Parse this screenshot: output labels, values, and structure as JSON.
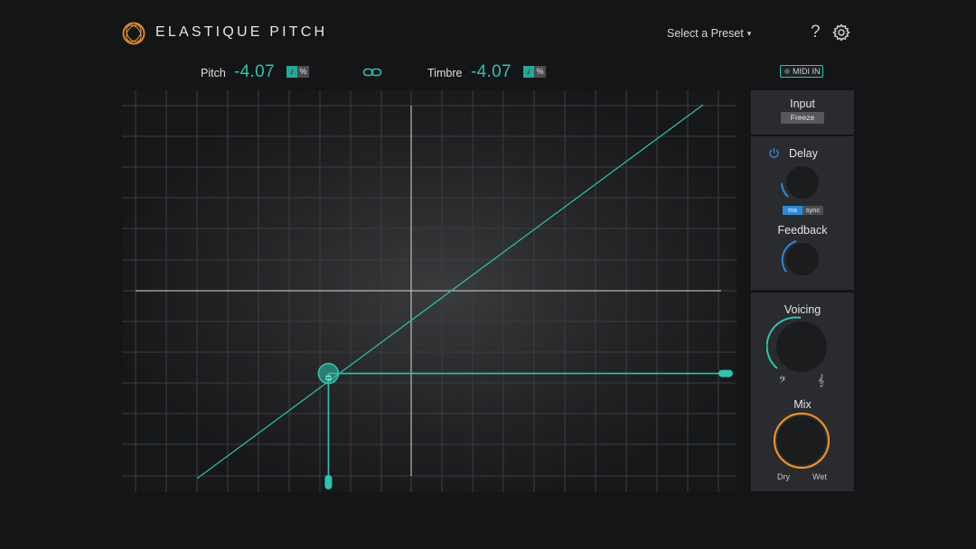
{
  "header": {
    "app_title": "ELASTIQUE PITCH",
    "preset_label": "Select a Preset",
    "preset_caret": "▾",
    "help_label": "?"
  },
  "pitch": {
    "label": "Pitch",
    "value": "-4.07",
    "unit_percent": "%"
  },
  "timbre": {
    "label": "Timbre",
    "value": "-4.07",
    "unit_percent": "%"
  },
  "midi": {
    "label": "MIDI IN",
    "active": false
  },
  "graph": {
    "pitch_value": -4.07,
    "timbre_value": -4.07,
    "accent_color": "#2ec4ae"
  },
  "input_section": {
    "title": "Input",
    "freeze_label": "Freeze"
  },
  "delay_section": {
    "title": "Delay",
    "power_on": true,
    "ms_label": "ms",
    "sync_label": "sync",
    "feedback_title": "Feedback"
  },
  "voicing_section": {
    "title": "Voicing",
    "low_symbol": "𝄢",
    "high_symbol": "𝄞"
  },
  "mix_section": {
    "title": "Mix",
    "dry_label": "Dry",
    "wet_label": "Wet"
  },
  "colors": {
    "accent": "#2ec4ae",
    "logo_orange": "#e8922a",
    "knob_arc_blue": "#2e89d8",
    "mix_ring_orange": "#e8922a",
    "background": "#141517",
    "panel": "#2a2b2e"
  },
  "icons": {
    "logo": "orbit-logo-icon",
    "help": "question-icon",
    "settings": "gear-icon",
    "link": "chain-link-icon",
    "power": "power-icon",
    "note_toggle": "music-note-icon"
  }
}
